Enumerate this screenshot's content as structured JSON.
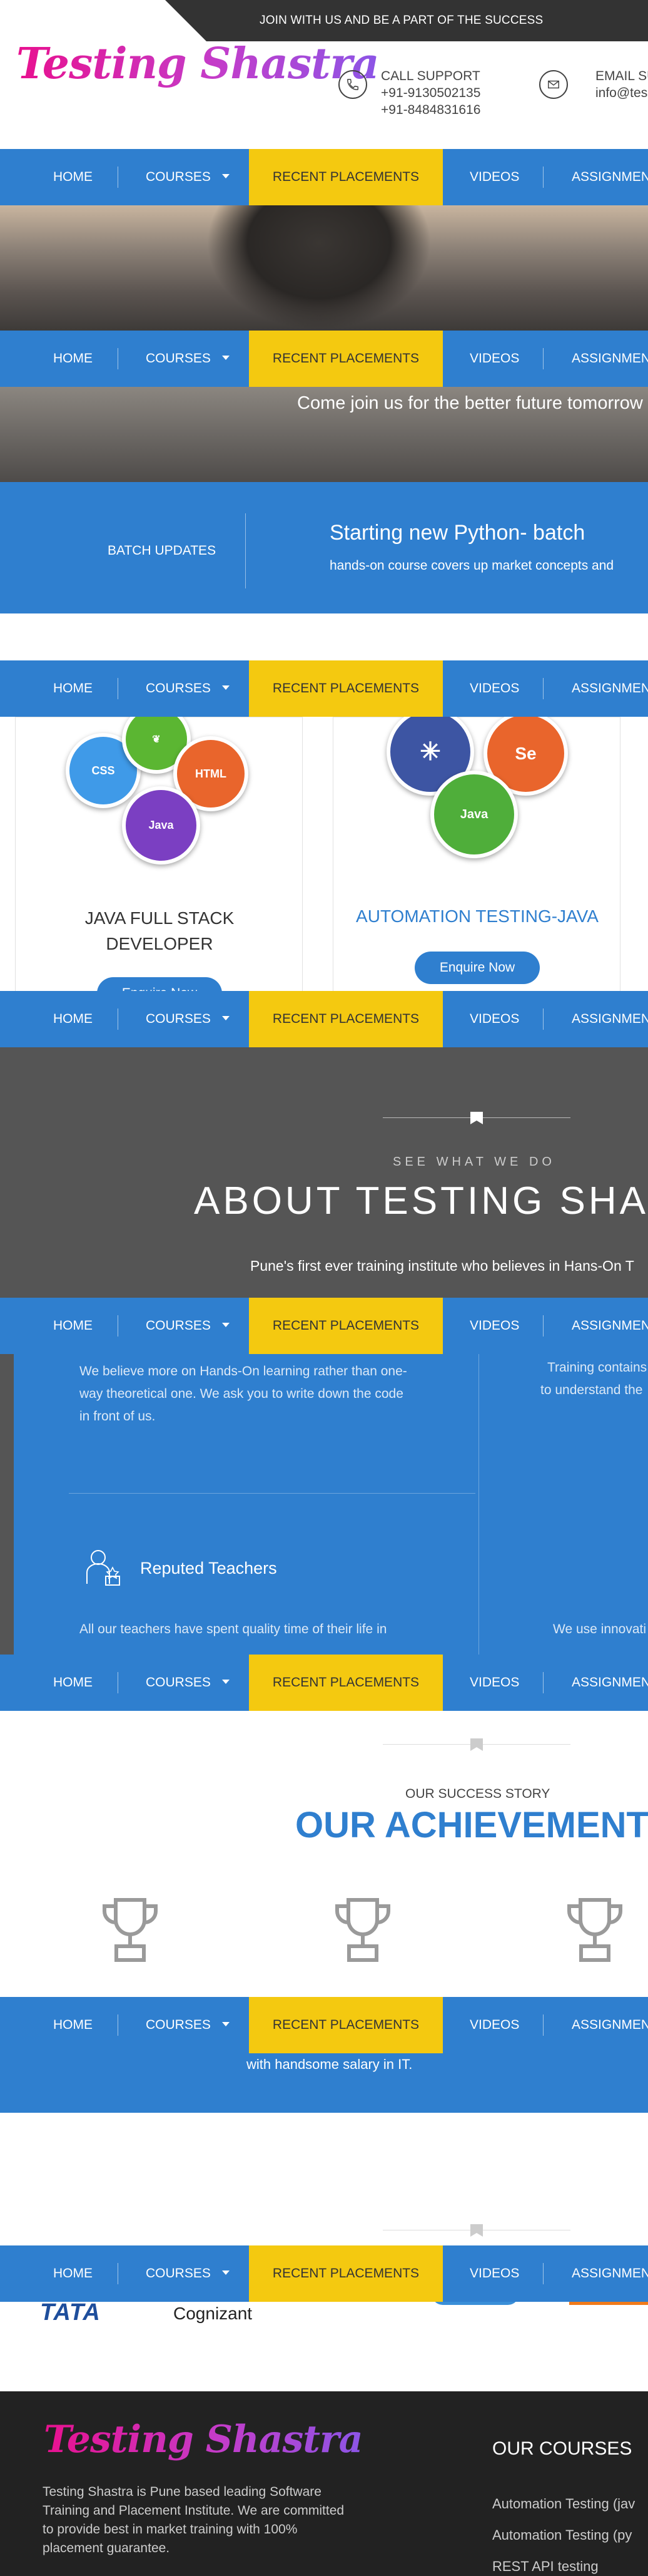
{
  "top_strip": {
    "text": "JOIN WITH US AND BE A PART OF THE SUCCESS"
  },
  "header": {
    "logo": "Testing Shastra",
    "call_support": {
      "label": "CALL SUPPORT",
      "phone1": "+91-9130502135",
      "phone2": "+91-8484831616",
      "icon": "phone-icon"
    },
    "email_support": {
      "label": "EMAIL SU",
      "email": "info@tes",
      "icon": "mail-icon"
    }
  },
  "nav": {
    "home": "HOME",
    "courses": "COURSES",
    "recent_placements": "RECENT PLACEMENTS",
    "videos": "VIDEOS",
    "assignments": "ASSIGNMEN"
  },
  "hero": {
    "tagline": "Come join us for the better future tomorrow"
  },
  "batch": {
    "label": "BATCH UPDATES",
    "title": "Starting new Python- batch",
    "subtitle": "hands-on course covers up market concepts and"
  },
  "courses": [
    {
      "title_line1": "JAVA FULL STACK",
      "title_line2": "DEVELOPER",
      "button": "Enquire Now",
      "logos": [
        "CSS",
        "HTML",
        "Java"
      ]
    },
    {
      "title": "AUTOMATION TESTING-JAVA",
      "button": "Enquire Now",
      "logos": [
        "Se",
        "Java"
      ]
    }
  ],
  "about": {
    "eyebrow": "SEE WHAT WE DO",
    "title": "ABOUT TESTING SHA",
    "subtitle": "Pune's first ever training institute who believes in Hans-On T"
  },
  "features": {
    "col1_text": "We believe more on Hands-On learning rather than one-way theoretical one. We ask you to write down the code in front of us.",
    "col1_line1": "We believe more on Hands-On learning rather than one-",
    "col1_line2": "way theoretical one. We ask you to write down the code",
    "col1_line3": "in front of us.",
    "col2_line1": "Training contains",
    "col2_line2": "to understand the",
    "reputed_title": "Reputed Teachers",
    "reputed_text": "All our teachers have spent quality time of their life in",
    "col2_bottom": "We use innovati"
  },
  "achievements": {
    "eyebrow": "OUR SUCCESS STORY",
    "title": "OUR ACHIEVEMENT",
    "bottom_text": "with handsome salary in IT."
  },
  "clients": {
    "logo1": "TATA",
    "logo2": "Cognizant"
  },
  "footer": {
    "logo": "Testing Shastra",
    "about_line1": "Testing Shastra is Pune based leading Software",
    "about_line2": "Training and Placement Institute. We are committed",
    "about_line3": "to provide best in market training with 100%",
    "about_line4": "placement guarantee.",
    "courses_title": "OUR COURSES",
    "course1": "Automation Testing (jav",
    "course2": "Automation Testing (py",
    "course3": "REST API testing"
  },
  "colors": {
    "primary_blue": "#2f7fcf",
    "highlight_yellow": "#f4c910",
    "dark": "#333333",
    "footer": "#222222"
  }
}
